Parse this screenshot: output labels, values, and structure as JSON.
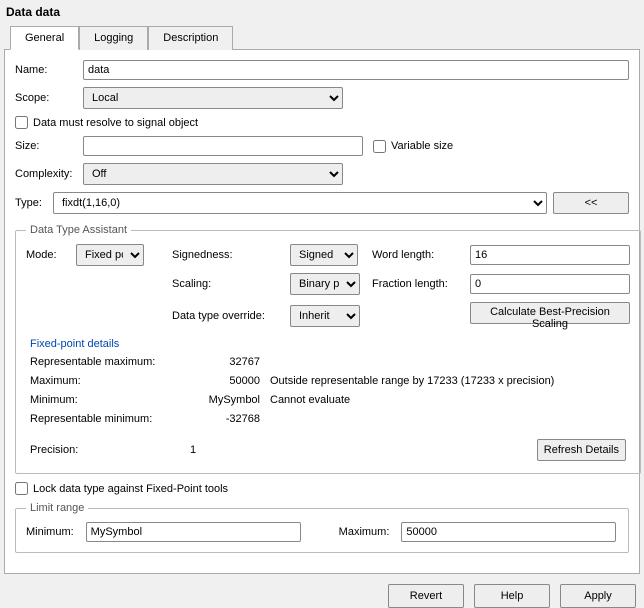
{
  "title": "Data data",
  "tabs": [
    {
      "label": "General"
    },
    {
      "label": "Logging"
    },
    {
      "label": "Description"
    }
  ],
  "form": {
    "name_label": "Name:",
    "name_value": "data",
    "scope_label": "Scope:",
    "scope_value": "Local",
    "resolve_label": "Data must resolve to signal object",
    "size_label": "Size:",
    "size_value": "",
    "variable_size_label": "Variable size",
    "complexity_label": "Complexity:",
    "complexity_value": "Off",
    "type_label": "Type:",
    "type_value": "fixdt(1,16,0)",
    "collapse_label": "<<"
  },
  "dta": {
    "legend": "Data Type Assistant",
    "mode_label": "Mode:",
    "mode_value": "Fixed point",
    "signedness_label": "Signedness:",
    "signedness_value": "Signed",
    "wordlen_label": "Word length:",
    "wordlen_value": "16",
    "scaling_label": "Scaling:",
    "scaling_value": "Binary point",
    "fraclen_label": "Fraction length:",
    "fraclen_value": "0",
    "override_label": "Data type override:",
    "override_value": "Inherit",
    "calc_label": "Calculate Best-Precision Scaling"
  },
  "fpd": {
    "title": "Fixed-point details",
    "rep_max_label": "Representable maximum:",
    "rep_max_value": "32767",
    "max_label": "Maximum:",
    "max_value": "50000",
    "max_note": "Outside representable range by 17233 (17233 x precision)",
    "min_label": "Minimum:",
    "min_value": "MySymbol",
    "min_note": "Cannot evaluate",
    "rep_min_label": "Representable minimum:",
    "rep_min_value": "-32768",
    "precision_label": "Precision:",
    "precision_value": "1",
    "refresh_label": "Refresh Details"
  },
  "lock_label": "Lock data type against Fixed-Point tools",
  "limit": {
    "legend": "Limit range",
    "min_label": "Minimum:",
    "min_value": "MySymbol",
    "max_label": "Maximum:",
    "max_value": "50000"
  },
  "footer": {
    "revert": "Revert",
    "help": "Help",
    "apply": "Apply"
  }
}
